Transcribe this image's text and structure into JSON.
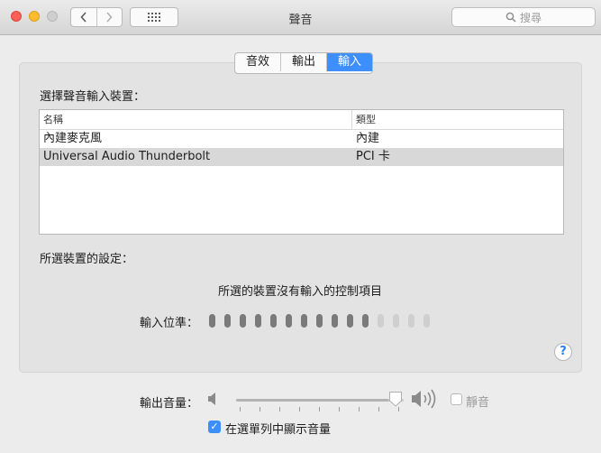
{
  "window": {
    "title": "聲音",
    "search_placeholder": "搜尋"
  },
  "tabs": [
    {
      "label": "音效",
      "active": false
    },
    {
      "label": "輸出",
      "active": false
    },
    {
      "label": "輸入",
      "active": true
    }
  ],
  "input_panel": {
    "select_device_label": "選擇聲音輸入裝置：",
    "columns": {
      "name": "名稱",
      "type": "類型"
    },
    "devices": [
      {
        "name": "內建麥克風",
        "type": "內建",
        "selected": false
      },
      {
        "name": "Universal Audio Thunderbolt",
        "type": "PCI 卡",
        "selected": true
      }
    ],
    "settings_label": "所選裝置的設定：",
    "no_controls_message": "所選的裝置沒有輸入的控制項目",
    "input_level_label": "輸入位準：",
    "input_level": {
      "lit": 11,
      "total": 15
    }
  },
  "footer": {
    "output_volume_label": "輸出音量：",
    "output_volume": 0.95,
    "mute_label": "靜音",
    "mute_checked": false,
    "show_in_menu_bar_label": "在選單列中顯示音量",
    "show_in_menu_bar_checked": true
  },
  "colors": {
    "accent": "#3d8ffe",
    "close": "#fc5f57",
    "minimize": "#fdbc2e"
  }
}
